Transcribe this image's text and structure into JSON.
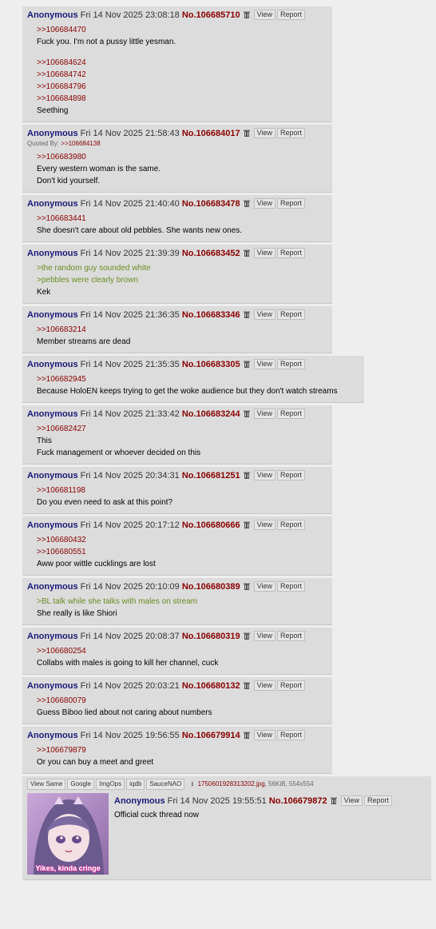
{
  "ui": {
    "view_label": "View",
    "report_label": "Report",
    "quoted_by_label": "Quoted By:"
  },
  "colors": {
    "name": "#1a1a7a",
    "post_number": "#8b0000",
    "quotelink": "#8b0000",
    "greentext": "#6b8e23",
    "post_bg": "#dcdcdc",
    "page_bg": "#eeeeee"
  },
  "posts": [
    {
      "name": "Anonymous",
      "date": "Fri 14 Nov 2025 23:08:18",
      "number": "No.106685710",
      "lines": [
        {
          "t": "q",
          "text": ">>106684470"
        },
        {
          "t": "p",
          "text": "Fuck you. I'm not a pussy little yesman."
        },
        {
          "t": "gap",
          "text": ""
        },
        {
          "t": "q",
          "text": ">>106684624"
        },
        {
          "t": "q",
          "text": ">>106684742"
        },
        {
          "t": "q",
          "text": ">>106684796"
        },
        {
          "t": "q",
          "text": ">>106684898"
        },
        {
          "t": "p",
          "text": "Seething"
        }
      ]
    },
    {
      "name": "Anonymous",
      "date": "Fri 14 Nov 2025 21:58:43",
      "number": "No.106684017",
      "quoted_by": ">>106684138",
      "lines": [
        {
          "t": "q",
          "text": ">>106683980"
        },
        {
          "t": "p",
          "text": "Every western woman is the same."
        },
        {
          "t": "p",
          "text": "Don't kid yourself."
        }
      ]
    },
    {
      "name": "Anonymous",
      "date": "Fri 14 Nov 2025 21:40:40",
      "number": "No.106683478",
      "lines": [
        {
          "t": "q",
          "text": ">>106683441"
        },
        {
          "t": "p",
          "text": "She doesn't care about old pebbles. She wants new ones."
        }
      ]
    },
    {
      "name": "Anonymous",
      "date": "Fri 14 Nov 2025 21:39:39",
      "number": "No.106683452",
      "lines": [
        {
          "t": "g",
          "text": ">the random guy sounded white"
        },
        {
          "t": "g",
          "text": ">pebbles were clearly brown"
        },
        {
          "t": "p",
          "text": "Kek"
        }
      ]
    },
    {
      "name": "Anonymous",
      "date": "Fri 14 Nov 2025 21:36:35",
      "number": "No.106683346",
      "lines": [
        {
          "t": "q",
          "text": ">>106683214"
        },
        {
          "t": "p",
          "text": "Member streams are dead"
        }
      ]
    },
    {
      "name": "Anonymous",
      "date": "Fri 14 Nov 2025 21:35:35",
      "number": "No.106683305",
      "wide": true,
      "lines": [
        {
          "t": "q",
          "text": ">>106682945"
        },
        {
          "t": "p",
          "text": "Because HoloEN keeps trying to get the woke audience but they don't watch streams"
        }
      ]
    },
    {
      "name": "Anonymous",
      "date": "Fri 14 Nov 2025 21:33:42",
      "number": "No.106683244",
      "lines": [
        {
          "t": "q",
          "text": ">>106682427"
        },
        {
          "t": "p",
          "text": "This"
        },
        {
          "t": "p",
          "text": "Fuck management or whoever decided on this"
        }
      ]
    },
    {
      "name": "Anonymous",
      "date": "Fri 14 Nov 2025 20:34:31",
      "number": "No.106681251",
      "lines": [
        {
          "t": "q",
          "text": ">>106681198"
        },
        {
          "t": "p",
          "text": "Do you even need to ask at this point?"
        }
      ]
    },
    {
      "name": "Anonymous",
      "date": "Fri 14 Nov 2025 20:17:12",
      "number": "No.106680666",
      "lines": [
        {
          "t": "q",
          "text": ">>106680432"
        },
        {
          "t": "q",
          "text": ">>106680551"
        },
        {
          "t": "p",
          "text": "Aww poor wittle cucklings are lost"
        }
      ]
    },
    {
      "name": "Anonymous",
      "date": "Fri 14 Nov 2025 20:10:09",
      "number": "No.106680389",
      "lines": [
        {
          "t": "g",
          "text": ">BL talk while she talks with males on stream"
        },
        {
          "t": "p",
          "text": "She really is like Shiori"
        }
      ]
    },
    {
      "name": "Anonymous",
      "date": "Fri 14 Nov 2025 20:08:37",
      "number": "No.106680319",
      "lines": [
        {
          "t": "q",
          "text": ">>106680254"
        },
        {
          "t": "p",
          "text": "Collabs with males is going to kill her channel, cuck"
        }
      ]
    },
    {
      "name": "Anonymous",
      "date": "Fri 14 Nov 2025 20:03:21",
      "number": "No.106680132",
      "lines": [
        {
          "t": "q",
          "text": ">>106680079"
        },
        {
          "t": "p",
          "text": "Guess Biboo lied about not caring about numbers"
        }
      ]
    },
    {
      "name": "Anonymous",
      "date": "Fri 14 Nov 2025 19:56:55",
      "number": "No.106679914",
      "lines": [
        {
          "t": "q",
          "text": ">>106679879"
        },
        {
          "t": "p",
          "text": "Or you can buy a meet and greet"
        }
      ]
    }
  ],
  "op": {
    "search_buttons": [
      "View Same",
      "Google",
      "ImgOps",
      "iqdb",
      "SauceNAO"
    ],
    "download_icon": "download-icon",
    "filename": "1750601928313202.jpg",
    "file_meta": ", 56KiB, 554x554",
    "thumbnail_caption": "Yikes, kinda cringe",
    "name": "Anonymous",
    "date": "Fri 14 Nov 2025 19:55:51",
    "number": "No.106679872",
    "comment": "Official cuck thread now"
  }
}
